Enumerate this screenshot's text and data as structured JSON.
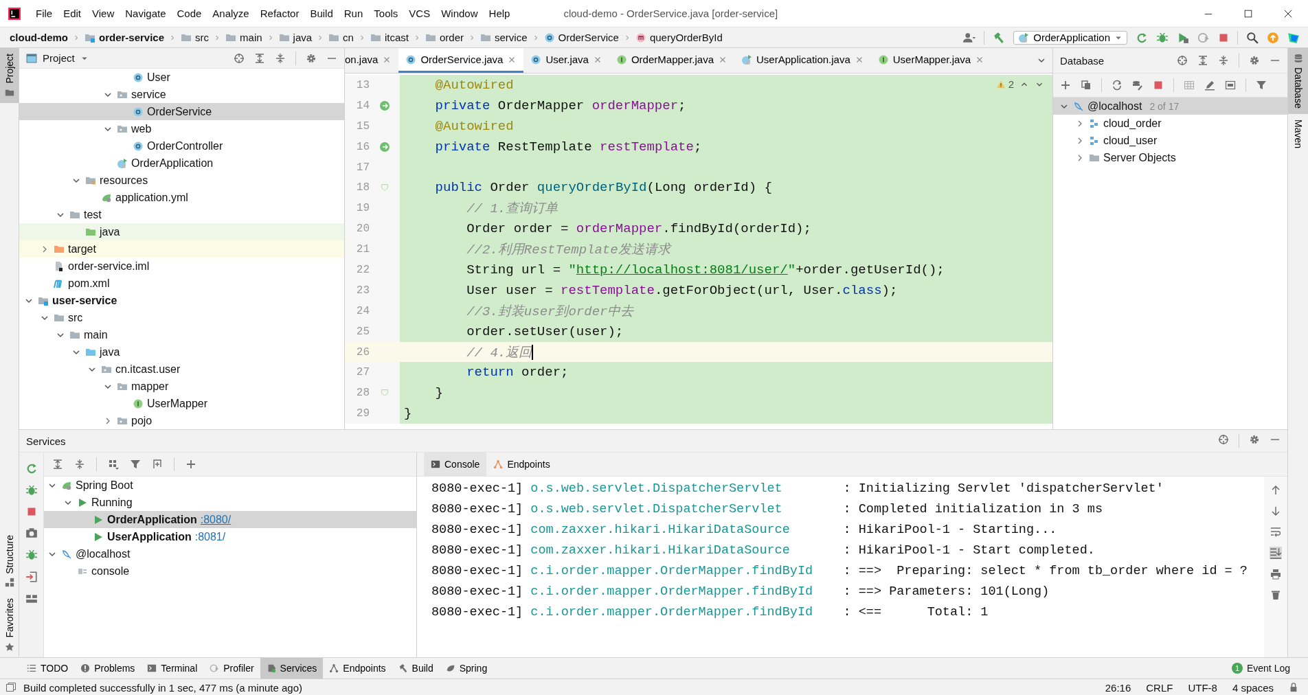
{
  "window": {
    "title": "cloud-demo - OrderService.java [order-service]"
  },
  "menu": [
    "File",
    "Edit",
    "View",
    "Navigate",
    "Code",
    "Analyze",
    "Refactor",
    "Build",
    "Run",
    "Tools",
    "VCS",
    "Window",
    "Help"
  ],
  "breadcrumbs": [
    {
      "label": "cloud-demo",
      "kind": "project"
    },
    {
      "label": "order-service",
      "kind": "module"
    },
    {
      "label": "src",
      "kind": "folder"
    },
    {
      "label": "main",
      "kind": "folder"
    },
    {
      "label": "java",
      "kind": "folder"
    },
    {
      "label": "cn",
      "kind": "folder"
    },
    {
      "label": "itcast",
      "kind": "folder"
    },
    {
      "label": "order",
      "kind": "folder"
    },
    {
      "label": "service",
      "kind": "folder"
    },
    {
      "label": "OrderService",
      "kind": "class"
    },
    {
      "label": "queryOrderById",
      "kind": "method"
    }
  ],
  "run_configuration": "OrderApplication",
  "left_stripe": {
    "top": [
      {
        "label": "Project",
        "kind": "project",
        "selected": true
      }
    ],
    "bottom": [
      {
        "label": "Structure",
        "kind": "structure",
        "selected": false
      },
      {
        "label": "Favorites",
        "kind": "favorites",
        "selected": false
      }
    ]
  },
  "project": {
    "title": "Project",
    "tree": [
      {
        "children": [
          {
            "children": [
              {
                "children": [
                  {
                    "children": [
                      {
                        "children": [
                          {
                            "children": [
                              {
                                "label": "User",
                                "kind": "class",
                                "selected": false
                              }
                            ]
                          },
                          {
                            "label": "service",
                            "kind": "package",
                            "expanded": true,
                            "selected": false,
                            "children": [
                              {
                                "label": "OrderService",
                                "kind": "class",
                                "selected": true
                              }
                            ]
                          },
                          {
                            "label": "web",
                            "kind": "package",
                            "expanded": true,
                            "selected": false,
                            "children": [
                              {
                                "label": "OrderController",
                                "kind": "class",
                                "selected": false
                              }
                            ]
                          },
                          {
                            "label": "OrderApplication",
                            "kind": "spring-class",
                            "selected": false
                          }
                        ]
                      }
                    ]
                  },
                  {
                    "label": "resources",
                    "kind": "resources",
                    "expanded": true,
                    "selected": false,
                    "children": [
                      {
                        "label": "application.yml",
                        "kind": "spring-yml",
                        "selected": false
                      }
                    ]
                  }
                ]
              },
              {
                "label": "test",
                "kind": "folder",
                "expanded": true,
                "selected": false,
                "children": [
                  {
                    "label": "java",
                    "kind": "test-root",
                    "selected": false
                  }
                ]
              }
            ]
          },
          {
            "label": "target",
            "kind": "excluded",
            "expanded": false,
            "selected": false
          },
          {
            "label": "order-service.iml",
            "kind": "iml",
            "selected": false
          },
          {
            "label": "pom.xml",
            "kind": "maven",
            "selected": false
          }
        ]
      },
      {
        "label": "user-service",
        "kind": "module",
        "expanded": true,
        "selected": false,
        "children": [
          {
            "label": "src",
            "kind": "folder",
            "expanded": true,
            "selected": false,
            "children": [
              {
                "label": "main",
                "kind": "folder",
                "expanded": true,
                "selected": false,
                "children": [
                  {
                    "label": "java",
                    "kind": "source-root",
                    "expanded": true,
                    "selected": false,
                    "children": [
                      {
                        "label": "cn.itcast.user",
                        "kind": "package",
                        "expanded": true,
                        "selected": false,
                        "children": [
                          {
                            "label": "mapper",
                            "kind": "package",
                            "expanded": true,
                            "selected": false,
                            "children": [
                              {
                                "label": "UserMapper",
                                "kind": "interface",
                                "selected": false
                              }
                            ]
                          },
                          {
                            "label": "pojo",
                            "kind": "package",
                            "expanded": false,
                            "selected": false
                          }
                        ]
                      }
                    ]
                  }
                ]
              }
            ]
          }
        ]
      }
    ]
  },
  "editor": {
    "tabs": [
      {
        "label": "on.java",
        "selected": false
      },
      {
        "label": "OrderService.java",
        "kind": "class",
        "selected": true
      },
      {
        "label": "User.java",
        "kind": "class",
        "selected": false
      },
      {
        "label": "OrderMapper.java",
        "kind": "interface",
        "selected": false
      },
      {
        "label": "UserApplication.java",
        "kind": "spring-class",
        "selected": false
      },
      {
        "label": "UserMapper.java",
        "kind": "interface",
        "selected": false
      }
    ],
    "warnings": "2",
    "lines": [
      {
        "number": "13",
        "current": false,
        "tokens": [
          {
            "text": "    @Autowired",
            "kind": "annotation"
          }
        ]
      },
      {
        "number": "14",
        "current": false,
        "gutter": {
          "kind": "bean"
        },
        "tokens": [
          {
            "text": "    private",
            "kind": "keyword"
          },
          {
            "text": " OrderMapper "
          },
          {
            "text": "orderMapper",
            "kind": "field"
          },
          {
            "text": ";"
          }
        ]
      },
      {
        "number": "15",
        "current": false,
        "tokens": [
          {
            "text": "    @Autowired",
            "kind": "annotation"
          }
        ]
      },
      {
        "number": "16",
        "current": false,
        "gutter": {
          "kind": "bean"
        },
        "tokens": [
          {
            "text": "    private",
            "kind": "keyword"
          },
          {
            "text": " RestTemplate "
          },
          {
            "text": "restTemplate",
            "kind": "field"
          },
          {
            "text": ";"
          }
        ]
      },
      {
        "number": "17",
        "current": false
      },
      {
        "number": "18",
        "current": false,
        "gutter": {
          "kind": "fold"
        },
        "tokens": [
          {
            "text": "    public",
            "kind": "keyword"
          },
          {
            "text": " Order "
          },
          {
            "text": "queryOrderById",
            "kind": "method"
          },
          {
            "text": "(Long orderId) {"
          }
        ]
      },
      {
        "number": "19",
        "current": false,
        "tokens": [
          {
            "text": "        // 1.查询订单",
            "kind": "comment"
          }
        ]
      },
      {
        "number": "20",
        "current": false,
        "tokens": [
          {
            "text": "        Order order = "
          },
          {
            "text": "orderMapper",
            "kind": "field"
          },
          {
            "text": ".findById(orderId);"
          }
        ]
      },
      {
        "number": "21",
        "current": false,
        "tokens": [
          {
            "text": "        //2.利用RestTemplate发送请求",
            "kind": "comment"
          }
        ]
      },
      {
        "number": "22",
        "current": false,
        "tokens": [
          {
            "text": "        String url = "
          },
          {
            "text": "\"",
            "kind": "string"
          },
          {
            "text": "http://localhost:8081/user/",
            "kind": "link"
          },
          {
            "text": "\"",
            "kind": "string"
          },
          {
            "text": "+order.getUserId();"
          }
        ]
      },
      {
        "number": "23",
        "current": false,
        "tokens": [
          {
            "text": "        User user = "
          },
          {
            "text": "restTemplate",
            "kind": "field"
          },
          {
            "text": ".getForObject(url, User."
          },
          {
            "text": "class",
            "kind": "keyword"
          },
          {
            "text": ");"
          }
        ]
      },
      {
        "number": "24",
        "current": false,
        "tokens": [
          {
            "text": "        //3.封装user到order中去",
            "kind": "comment"
          }
        ]
      },
      {
        "number": "25",
        "current": false,
        "tokens": [
          {
            "text": "        order.setUser(user);"
          }
        ]
      },
      {
        "number": "26",
        "current": true,
        "tokens": [
          {
            "text": "        // 4.返回",
            "kind": "comment"
          }
        ]
      },
      {
        "number": "27",
        "current": false,
        "tokens": [
          {
            "text": "        return",
            "kind": "keyword"
          },
          {
            "text": " order;"
          }
        ]
      },
      {
        "number": "28",
        "current": false,
        "gutter": {
          "kind": "fold"
        },
        "tokens": [
          {
            "text": "    }"
          }
        ]
      },
      {
        "number": "29",
        "current": false,
        "tokens": [
          {
            "text": "}"
          }
        ]
      }
    ]
  },
  "database": {
    "title": "Database",
    "tree": [
      {
        "label": "@localhost",
        "kind": "datasource",
        "note": "2 of 17",
        "expanded": true,
        "selected": true,
        "children": [
          {
            "label": "cloud_order",
            "kind": "schema",
            "expanded": false,
            "selected": false
          },
          {
            "label": "cloud_user",
            "kind": "schema",
            "expanded": false,
            "selected": false
          },
          {
            "label": "Server Objects",
            "kind": "folder",
            "expanded": false,
            "selected": false
          }
        ]
      }
    ]
  },
  "right_stripe": [
    {
      "label": "Database",
      "kind": "database",
      "selected": true
    },
    {
      "label": "Maven",
      "kind": "maven",
      "selected": false
    }
  ],
  "services": {
    "title": "Services",
    "tree": [
      {
        "label": "Spring Boot",
        "kind": "spring",
        "expanded": true,
        "selected": false,
        "children": [
          {
            "label": "Running",
            "kind": "running",
            "expanded": true,
            "selected": false,
            "children": [
              {
                "label": "OrderApplication",
                "kind": "app",
                "port": ":8080/",
                "selected": true
              },
              {
                "label": "UserApplication",
                "kind": "app",
                "port": ":8081/",
                "selected": false
              }
            ]
          }
        ]
      },
      {
        "label": "@localhost",
        "kind": "datasource",
        "expanded": true,
        "selected": false,
        "children": [
          {
            "label": "console",
            "kind": "db-console",
            "selected": false
          }
        ]
      }
    ],
    "console_tabs": [
      {
        "label": "Console",
        "kind": "console",
        "selected": true
      },
      {
        "label": "Endpoints",
        "kind": "endpoints",
        "selected": false
      }
    ],
    "console": [
      {
        "thread": "8080-exec-1]",
        "logger": "o.s.web.servlet.DispatcherServlet",
        "message": ": Initializing Servlet 'dispatcherServlet'"
      },
      {
        "thread": "8080-exec-1]",
        "logger": "o.s.web.servlet.DispatcherServlet",
        "message": ": Completed initialization in 3 ms"
      },
      {
        "thread": "8080-exec-1]",
        "logger": "com.zaxxer.hikari.HikariDataSource",
        "message": ": HikariPool-1 - Starting..."
      },
      {
        "thread": "8080-exec-1]",
        "logger": "com.zaxxer.hikari.HikariDataSource",
        "message": ": HikariPool-1 - Start completed."
      },
      {
        "thread": "8080-exec-1]",
        "logger": "c.i.order.mapper.OrderMapper.findById",
        "message": ": ==>  Preparing: select * from tb_order where id = ?"
      },
      {
        "thread": "8080-exec-1]",
        "logger": "c.i.order.mapper.OrderMapper.findById",
        "message": ": ==> Parameters: 101(Long)"
      },
      {
        "thread": "8080-exec-1]",
        "logger": "c.i.order.mapper.OrderMapper.findById",
        "message": ": <==      Total: 1"
      }
    ]
  },
  "tool_tabs": [
    {
      "label": "TODO",
      "kind": "todo",
      "selected": false
    },
    {
      "label": "Problems",
      "kind": "problems",
      "selected": false
    },
    {
      "label": "Terminal",
      "kind": "terminal",
      "selected": false
    },
    {
      "label": "Profiler",
      "kind": "profiler",
      "selected": false
    },
    {
      "label": "Services",
      "kind": "services",
      "selected": true
    },
    {
      "label": "Endpoints",
      "kind": "endpoints",
      "selected": false
    },
    {
      "label": "Build",
      "kind": "build",
      "selected": false
    },
    {
      "label": "Spring",
      "kind": "spring",
      "selected": false
    }
  ],
  "event_log": {
    "label": "Event Log",
    "badge": "1"
  },
  "status_bar": {
    "message": "Build completed successfully in 1 sec, 477 ms (a minute ago)",
    "items": [
      "26:16",
      "CRLF",
      "UTF-8",
      "4 spaces"
    ]
  }
}
